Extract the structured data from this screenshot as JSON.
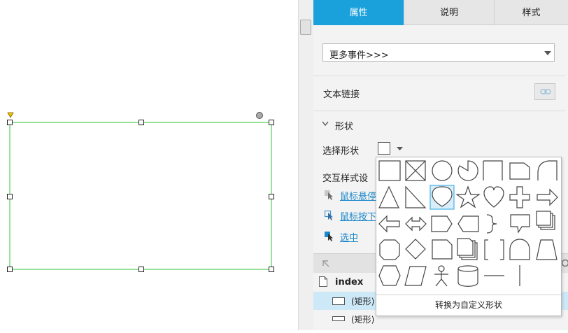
{
  "tabs": [
    {
      "label": "属性",
      "active": true
    },
    {
      "label": "说明",
      "active": false
    },
    {
      "label": "样式",
      "active": false
    }
  ],
  "event_dropdown": {
    "value": "更多事件>>>"
  },
  "text_link": {
    "label": "文本链接"
  },
  "shape_section": {
    "title": "形状",
    "select_label": "选择形状"
  },
  "interaction": {
    "title": "交互样式设",
    "items": [
      {
        "label": "鼠标悬停"
      },
      {
        "label": "鼠标按下"
      },
      {
        "label": "选中"
      }
    ]
  },
  "shape_popup": {
    "convert_label": "转换为自定义形状",
    "shapes": [
      [
        "rectangle",
        "crossed-rectangle",
        "ellipse",
        "pie",
        "rect-snipped-corner",
        "tab-shape",
        "curved-corner"
      ],
      [
        "triangle",
        "right-triangle",
        "speech-drop",
        "star",
        "heart",
        "plus",
        "arrow-right"
      ],
      [
        "arrow-left",
        "arrow-left-right",
        "pentagon-arrow",
        "tag-left",
        "brace-right",
        "callout",
        "stacked-pages"
      ],
      [
        "octagon",
        "diamond",
        "folded-page",
        "document-stack",
        "brackets",
        "bell-curve",
        "trapezoid"
      ],
      [
        "hexagon",
        "parallelogram",
        "actor",
        "database",
        "horizontal-line",
        "vertical-line"
      ]
    ],
    "selected": "speech-drop"
  },
  "tree": {
    "page": "index",
    "items": [
      {
        "label": "(矩形)",
        "selected": true
      },
      {
        "label": "(矩形)",
        "selected": false
      }
    ]
  },
  "colors": {
    "accent": "#1aa0db",
    "selection": "#33c433",
    "link": "#1a88c9"
  }
}
